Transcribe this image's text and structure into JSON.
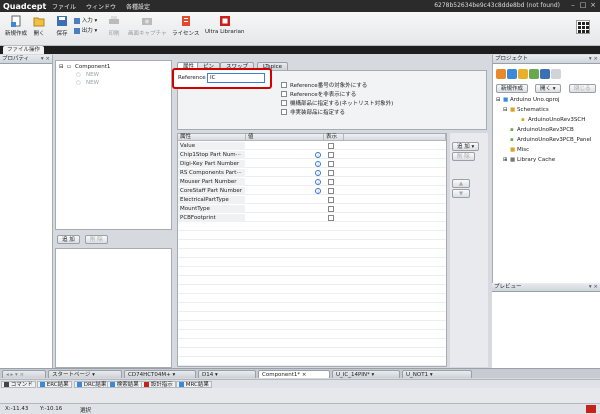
{
  "app": {
    "logo": "Quadcept",
    "menu": [
      "ファイル",
      "ウィンドウ",
      "各種設定"
    ],
    "title": "6278b52634be9c43c8dde8bd (not found)"
  },
  "toolbar": {
    "new_label": "新規作成",
    "open_label": "開く",
    "save_label": "保存",
    "input_label": "入力",
    "output_label": "出力",
    "print_label": "印刷",
    "capture_label": "画面キャプチャ",
    "license_label": "ライセンス",
    "ultra_label": "Ultra Librarian",
    "file_ops_tab": "ファイル操作"
  },
  "left_panel": {
    "title": "プロパティ"
  },
  "component_tree": {
    "root": "Component1",
    "children": [
      "NEW",
      "NEW"
    ],
    "add_button": "追 加",
    "delete_button": "削 除"
  },
  "tabs": [
    "属性",
    "ピン",
    "スワップ",
    "LTspice"
  ],
  "reference": {
    "label": "Reference",
    "value": "IC"
  },
  "options": [
    "Reference番号の対象外にする",
    "Referenceを非表示にする",
    "機構部品に指定する(ネットリスト対象外)",
    "非実装部品に指定する"
  ],
  "grid": {
    "headers": [
      "属性",
      "値",
      "表示"
    ],
    "rows": [
      {
        "name": "Value",
        "info": false
      },
      {
        "name": "Chip1Stop Part Num···",
        "info": true
      },
      {
        "name": "Digi-Key Part Number",
        "info": true
      },
      {
        "name": "RS Components Part···",
        "info": true
      },
      {
        "name": "Mouser Part Number",
        "info": true
      },
      {
        "name": "CoreStaff Part Number",
        "info": true
      },
      {
        "name": "ElectricalPartType",
        "info": false
      },
      {
        "name": "MountType",
        "info": false
      },
      {
        "name": "PCBFootprint",
        "info": false
      }
    ],
    "add_button": "追 加",
    "delete_button": "削 除"
  },
  "project": {
    "title": "プロジェクト",
    "new_button": "新規作成",
    "open_button": "開く",
    "close_button": "閉じる",
    "tree": {
      "root": "Arduino Uno.qproj",
      "schematics": "Schematics",
      "schematic_item": "ArduinoUnoRev3SCH",
      "pcb": "ArduinoUnoRev3PCB",
      "panel": "ArduinoUnoRev3PCB_Panel",
      "misc": "Misc",
      "library": "Library Cache"
    }
  },
  "preview": {
    "title": "プレビュー"
  },
  "doc_tabs": [
    "スタートページ",
    "CD74HCT04M+",
    "D14",
    "Component1*",
    "U_IC_14PIN*",
    "U_NOT1"
  ],
  "bottom_tabs": [
    "コマンド",
    "ERC結果",
    "DRC結果",
    "検索結果",
    "設計指示",
    "MRC結果"
  ],
  "status": {
    "x": "X:-11.43",
    "y": "Y:-10.16",
    "mode": "選択"
  }
}
